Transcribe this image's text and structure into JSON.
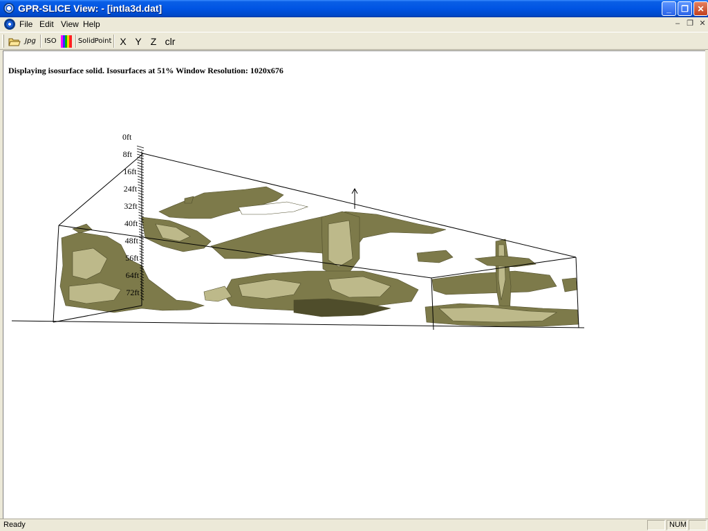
{
  "window": {
    "title": "GPR-SLICE View: - [intla3d.dat]",
    "controls": {
      "minimize": "_",
      "maximize": "❐",
      "close": "✕"
    }
  },
  "menu": {
    "items": [
      {
        "label": "File"
      },
      {
        "label": "Edit"
      },
      {
        "label": "View"
      },
      {
        "label": "Help"
      }
    ],
    "mdi_controls": {
      "minimize": "–",
      "restore": "❐",
      "close": "✕"
    }
  },
  "toolbar": {
    "buttons": [
      {
        "label": "",
        "icon": "open-folder-icon"
      },
      {
        "label": "Jpg",
        "icon": "jpg-export-icon"
      },
      {
        "label": "ISO",
        "icon": ""
      },
      {
        "label": "",
        "icon": "color-palette-icon"
      },
      {
        "label": "Solid",
        "icon": ""
      },
      {
        "label": "Point",
        "icon": ""
      },
      {
        "label": "X",
        "icon": ""
      },
      {
        "label": "Y",
        "icon": ""
      },
      {
        "label": "Z",
        "icon": ""
      },
      {
        "label": "clr",
        "icon": ""
      }
    ]
  },
  "viewer": {
    "info": "Displaying isosurface solid. Isosurfaces at 51% Window Resolution: 1020x676",
    "depth_axis": [
      "0ft",
      "8ft",
      "16ft",
      "24ft",
      "32ft",
      "40ft",
      "48ft",
      "56ft",
      "64ft",
      "72ft"
    ],
    "isosurface_color": "#7d7a4a",
    "isosurface_highlight": "#bdb98a",
    "isosurface_shadow": "#4f4d2b"
  },
  "status": {
    "text": "Ready",
    "num": "NUM"
  }
}
